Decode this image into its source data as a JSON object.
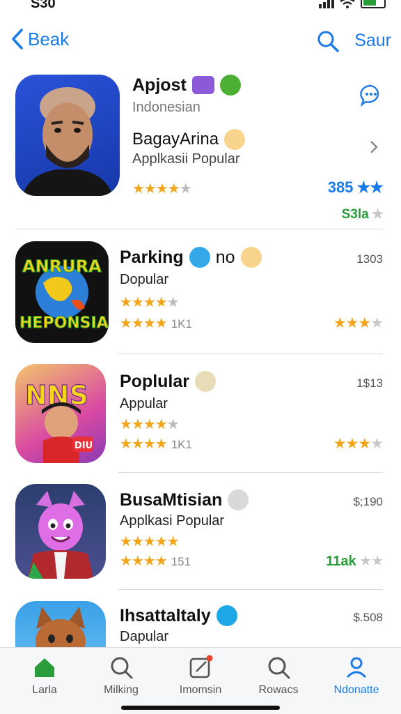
{
  "status": {
    "time": "S30"
  },
  "nav": {
    "back_label": "Beak",
    "right_label": "Saur"
  },
  "apps": [
    {
      "title": "Apjost",
      "subtitle": "Indonesian",
      "title2": "BagayArina",
      "subtitle2": "Applkasii Popular",
      "rating_stars": 3.5,
      "right_rating_text": "385",
      "right_rating_stars": 2,
      "extra_text": "S3la",
      "accent": "#1a7ae8"
    },
    {
      "title": "Parking",
      "title_suffix": "no",
      "subtitle": "Dopular",
      "rating_stars": 3.5,
      "rating2_stars": 4,
      "rating2_count": "1K1",
      "right_value": "1303",
      "right_rating_stars": 3,
      "icon_text_top": "ANRURA",
      "icon_text_bottom": "HEPONSIA"
    },
    {
      "title": "Poplular",
      "subtitle": "Appular",
      "rating_stars": 3.5,
      "rating2_stars": 4,
      "rating2_count": "1K1",
      "right_value": "1$13",
      "right_rating_stars": 3,
      "icon_text_top": "NNS",
      "icon_text_bottom": "DIU"
    },
    {
      "title": "BusaMtisian",
      "subtitle": "Applkasi Popular",
      "rating_stars": 4.5,
      "rating2_stars": 3.5,
      "rating2_count": "151",
      "right_value": "$;190",
      "right_rating_text": "11ak",
      "right_rating_stars": 0
    },
    {
      "title": "Ihsattaltaly",
      "subtitle": "Dapular",
      "right_value": "$.508"
    }
  ],
  "tabs": [
    {
      "label": "Larla",
      "icon": "home-icon"
    },
    {
      "label": "Milking",
      "icon": "search-icon"
    },
    {
      "label": "Imomsin",
      "icon": "edit-icon"
    },
    {
      "label": "Rowacs",
      "icon": "search-icon"
    },
    {
      "label": "Ndonatte",
      "icon": "person-icon"
    }
  ],
  "colors": {
    "accent": "#1a7ae8",
    "star": "#f2a41b",
    "green": "#2a9d3a"
  }
}
